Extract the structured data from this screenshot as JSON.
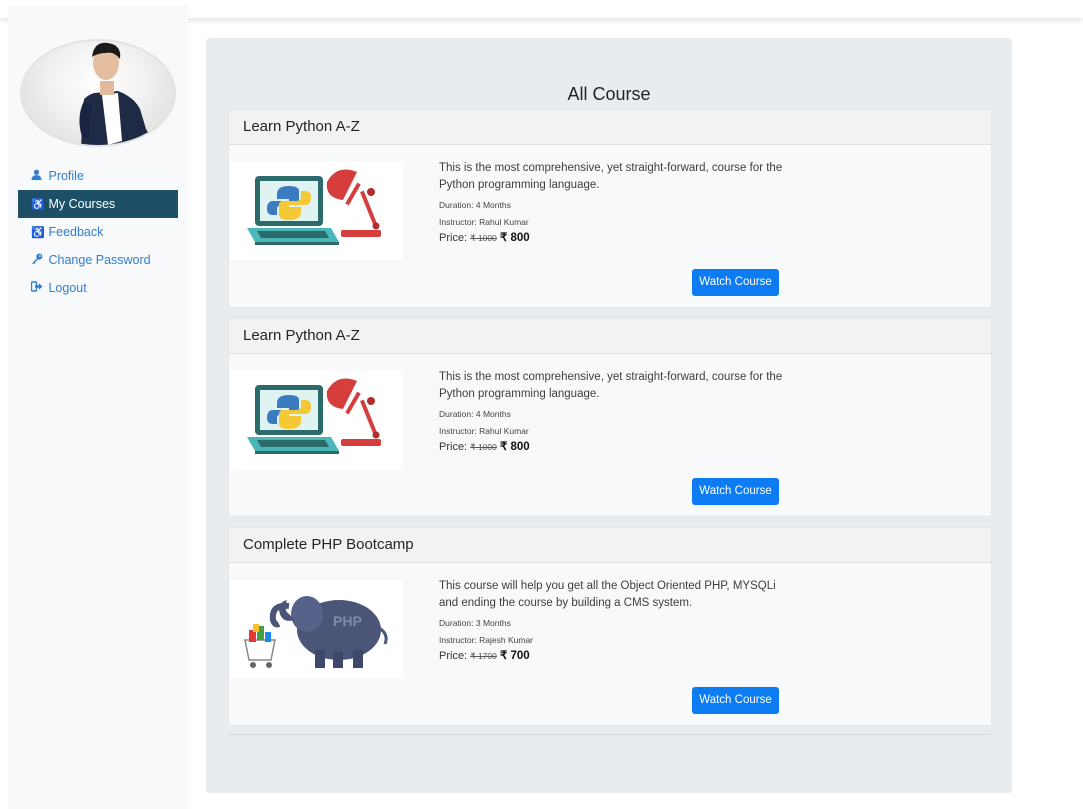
{
  "sidebar": {
    "nav": [
      {
        "label": "Profile",
        "icon": "user-icon"
      },
      {
        "label": "My Courses",
        "icon": "accessibility-icon",
        "active": true
      },
      {
        "label": "Feedback",
        "icon": "accessibility-icon"
      },
      {
        "label": "Change Password",
        "icon": "key-icon"
      },
      {
        "label": "Logout",
        "icon": "sign-out-icon"
      }
    ]
  },
  "main": {
    "title": "All Course",
    "courses": [
      {
        "title": "Learn Python A-Z",
        "desc": "This is the most comprehensive, yet straight-forward, course for the Python programming language.",
        "duration": "Duration: 4 Months",
        "instructor": "Instructor: Rahul Kumar",
        "price_label": "Price: ",
        "old_price": "₹ 1000",
        "new_price": "₹ 800",
        "button": "Watch Course",
        "image": "python-laptop-lamp"
      },
      {
        "title": "Learn Python A-Z",
        "desc": "This is the most comprehensive, yet straight-forward, course for the Python programming language.",
        "duration": "Duration: 4 Months",
        "instructor": "Instructor: Rahul Kumar",
        "price_label": "Price: ",
        "old_price": "₹ 1000",
        "new_price": "₹ 800",
        "button": "Watch Course",
        "image": "python-laptop-lamp"
      },
      {
        "title": "Complete PHP Bootcamp",
        "desc": "This course will help you get all the Object Oriented PHP, MYSQLi and ending the course by building a CMS system.",
        "duration": "Duration: 3 Months",
        "instructor": "Instructor: Rajesh Kumar",
        "price_label": "Price: ",
        "old_price": "₹ 1700",
        "new_price": "₹ 700",
        "button": "Watch Course",
        "image": "php-elephant-cart"
      }
    ]
  },
  "colors": {
    "accent": "#0d7cf2",
    "link": "#2f7fd0",
    "active_nav": "#1d4f66",
    "panel": "#e9ecef"
  }
}
